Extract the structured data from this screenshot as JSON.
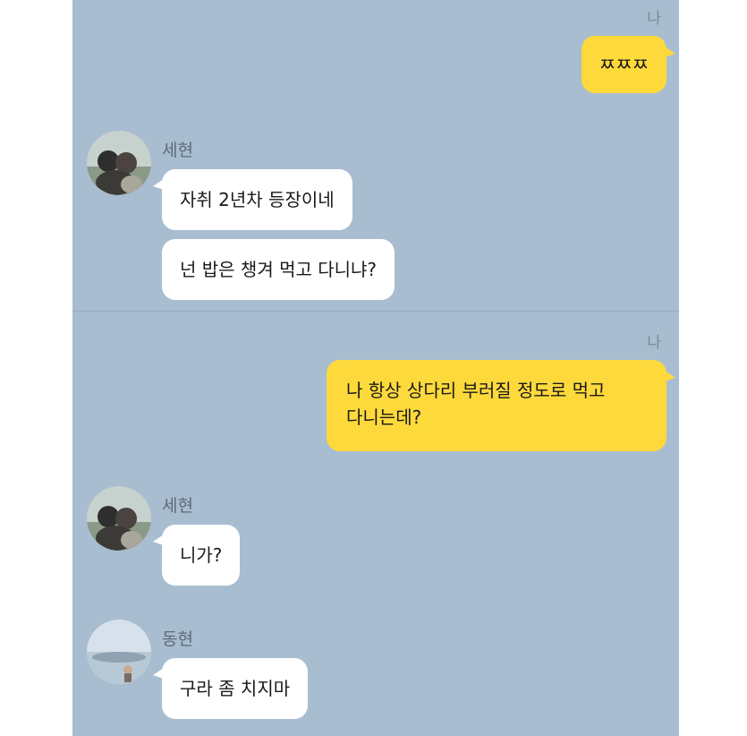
{
  "colors": {
    "chat_background": "#a9bdd1",
    "outgoing_bubble": "#fdd93b",
    "incoming_bubble": "#ffffff"
  },
  "messages": {
    "m1": {
      "sender": "나",
      "text": "ㅉㅉㅉ"
    },
    "group1": {
      "sender": "세현",
      "avatar_icon": "profile-photo-icon",
      "texts": [
        "자취 2년차 등장이네",
        "넌 밥은 챙겨 먹고 다니냐?"
      ]
    },
    "m2": {
      "sender": "나",
      "lines": [
        "나 항상 상다리 부러질 정도로 먹고",
        "다니는데?"
      ]
    },
    "group2": {
      "sender": "세현",
      "avatar_icon": "profile-photo-icon",
      "texts": [
        "니가?"
      ]
    },
    "group3": {
      "sender": "동현",
      "avatar_icon": "profile-photo-icon",
      "texts": [
        "구라 좀 치지마"
      ]
    }
  }
}
